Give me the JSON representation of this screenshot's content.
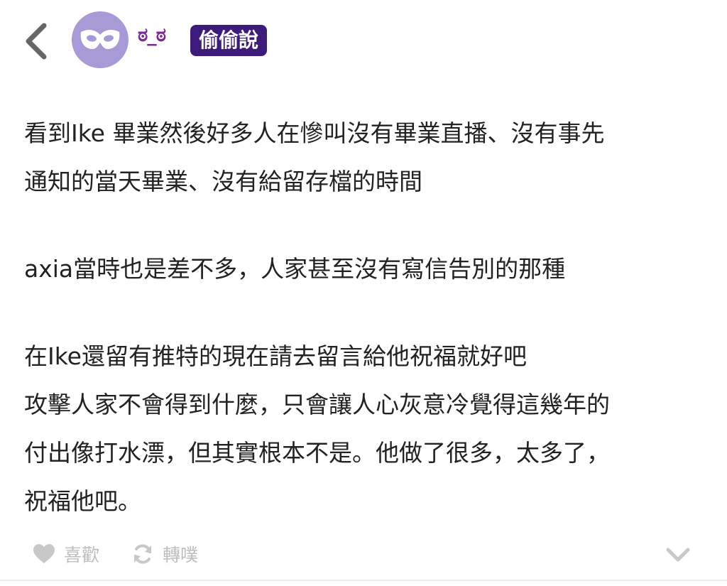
{
  "header": {
    "username": "ಠ_ಠ",
    "badge": "偷偷說"
  },
  "post": {
    "paragraphs": [
      "看到Ike 畢業然後好多人在慘叫沒有畢業直播、沒有事先\n通知的當天畢業、沒有給留存檔的時間",
      "axia當時也是差不多，人家甚至沒有寫信告別的那種",
      "在Ike還留有推特的現在請去留言給他祝福就好吧\n攻擊人家不會得到什麼，只會讓人心灰意冷覺得這幾年的\n付出像打水漂，但其實根本不是。他做了很多，太多了，\n祝福他吧。"
    ]
  },
  "actions": {
    "like_label": "喜歡",
    "share_label": "轉噗"
  },
  "colors": {
    "avatar_bg": "#a89ad6",
    "username": "#7b2b93",
    "badge_bg": "#3e1a7b",
    "muted": "#bdbdbd"
  },
  "icons": [
    "back-arrow-icon",
    "mask-icon",
    "heart-icon",
    "repost-icon",
    "chevron-down-icon"
  ]
}
